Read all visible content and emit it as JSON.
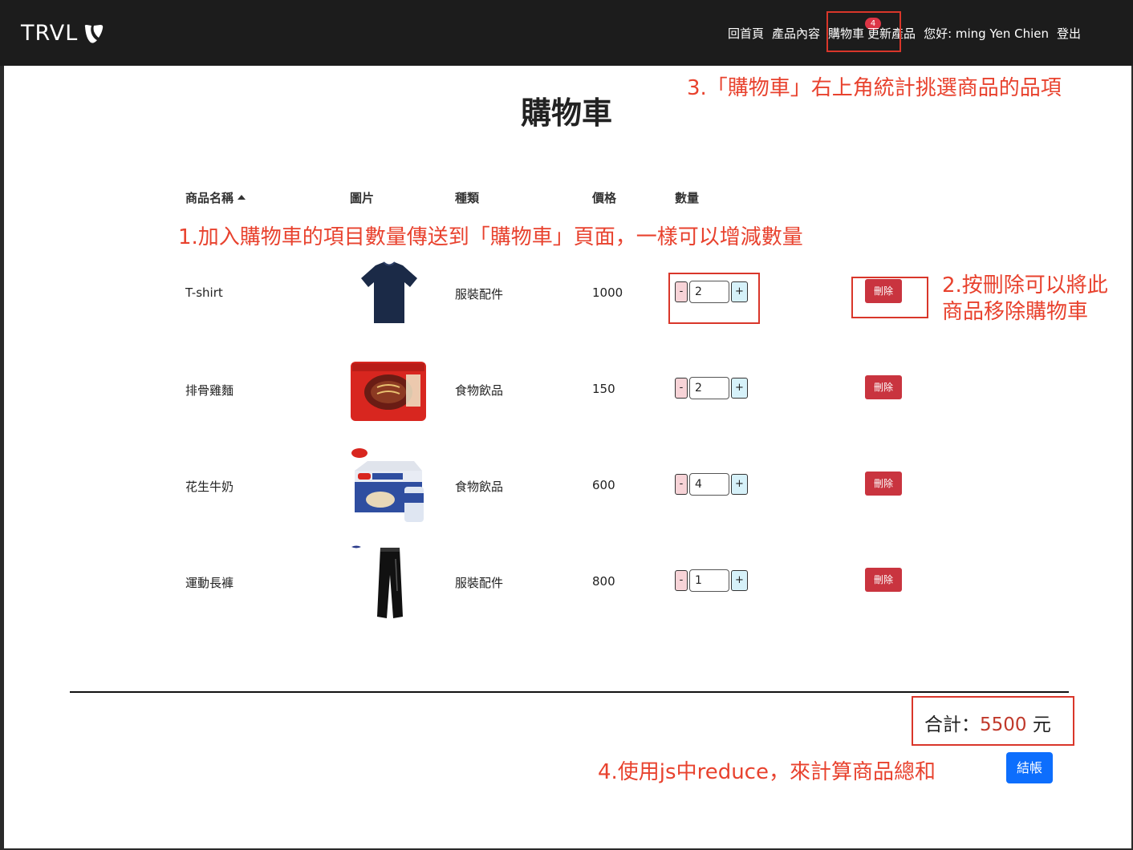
{
  "navbar": {
    "brand": "TRVL",
    "items": [
      {
        "label": "回首頁"
      },
      {
        "label": "產品內容"
      },
      {
        "label": "購物車",
        "badge": "4"
      },
      {
        "label": "更新產品"
      },
      {
        "label": "您好: ming Yen Chien"
      },
      {
        "label": "登出"
      }
    ]
  },
  "page": {
    "title": "購物車"
  },
  "table": {
    "headers": [
      "商品名稱",
      "圖片",
      "種類",
      "價格",
      "數量"
    ],
    "sort_column": "商品名稱",
    "delete_label": "刪除",
    "minus_label": "-",
    "plus_label": "+",
    "rows": [
      {
        "name": "T-shirt",
        "image_icon": "tshirt-image",
        "category": "服裝配件",
        "price": "1000",
        "qty": "2"
      },
      {
        "name": "排骨雞麵",
        "image_icon": "noodle-pack-image",
        "category": "食物飲品",
        "price": "150",
        "qty": "2"
      },
      {
        "name": "花生牛奶",
        "image_icon": "peanut-milk-box-image",
        "category": "食物飲品",
        "price": "600",
        "qty": "4"
      },
      {
        "name": "運動長褲",
        "image_icon": "track-pants-image",
        "category": "服裝配件",
        "price": "800",
        "qty": "1"
      }
    ]
  },
  "summary": {
    "total_label": "合計：",
    "total_value": "5500",
    "currency": "元",
    "checkout_label": "結帳"
  },
  "annotations": {
    "a1": "1.加入購物車的項目數量傳送到「購物車」頁面，一樣可以增減數量",
    "a2_line1": "2.按刪除可以將此",
    "a2_line2": "商品移除購物車",
    "a3": "3.「購物車」右上角統計挑選商品的品項",
    "a4": "4.使用js中reduce，來計算商品總和"
  },
  "colors": {
    "navbar_bg": "#1c1c1c",
    "annotation": "#e8422e",
    "delete_button": "#c9343f",
    "checkout_button": "#0d6efd",
    "badge": "#dc3545"
  }
}
